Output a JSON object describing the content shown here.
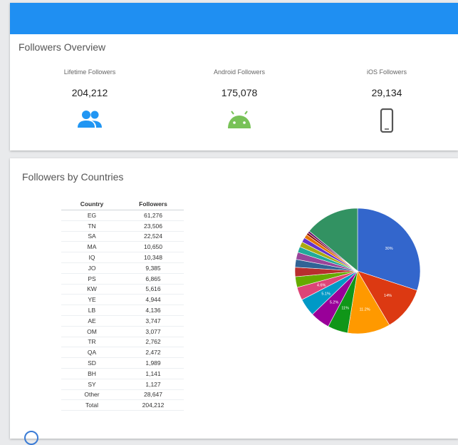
{
  "overview": {
    "title": "Followers Overview",
    "stats": [
      {
        "label": "Lifetime Followers",
        "value": "204,212",
        "icon": "people-icon",
        "color": "#2196f3"
      },
      {
        "label": "Android Followers",
        "value": "175,078",
        "icon": "android-icon",
        "color": "#78c257"
      },
      {
        "label": "iOS Followers",
        "value": "29,134",
        "icon": "smartphone-icon",
        "color": "#555555"
      }
    ]
  },
  "countries": {
    "title": "Followers by Countries",
    "headers": [
      "Country",
      "Followers"
    ],
    "rows": [
      [
        "EG",
        "61,276"
      ],
      [
        "TN",
        "23,506"
      ],
      [
        "SA",
        "22,524"
      ],
      [
        "MA",
        "10,650"
      ],
      [
        "IQ",
        "10,348"
      ],
      [
        "JO",
        "9,385"
      ],
      [
        "PS",
        "6,865"
      ],
      [
        "KW",
        "5,616"
      ],
      [
        "YE",
        "4,944"
      ],
      [
        "LB",
        "4,136"
      ],
      [
        "AE",
        "3,747"
      ],
      [
        "OM",
        "3,077"
      ],
      [
        "TR",
        "2,762"
      ],
      [
        "QA",
        "2,472"
      ],
      [
        "SD",
        "1,989"
      ],
      [
        "BH",
        "1,141"
      ],
      [
        "SY",
        "1,127"
      ],
      [
        "Other",
        "28,647"
      ],
      [
        "Total",
        "204,212"
      ]
    ]
  },
  "chart_data": {
    "type": "pie",
    "categories": [
      "EG",
      "TN",
      "SA",
      "MA",
      "IQ",
      "JO",
      "PS",
      "KW",
      "YE",
      "LB",
      "AE",
      "OM",
      "TR",
      "QA",
      "SD",
      "BH",
      "SY",
      "Other"
    ],
    "values": [
      61276,
      23506,
      22524,
      10650,
      10348,
      9385,
      6865,
      5616,
      4944,
      4136,
      3747,
      3077,
      2762,
      2472,
      1989,
      1141,
      1127,
      28647
    ],
    "slice_labels": [
      "30%",
      "14%",
      "11.2%",
      "11%",
      "5.2%",
      "5.1%",
      "4.6%"
    ],
    "colors": [
      "#3366cc",
      "#dc3912",
      "#ff9900",
      "#109618",
      "#990099",
      "#0099c6",
      "#dd4477",
      "#66aa00",
      "#b82e2e",
      "#316395",
      "#994499",
      "#22aa99",
      "#aaaa11",
      "#6633cc",
      "#e67300",
      "#8b0707",
      "#651067",
      "#329262"
    ]
  }
}
